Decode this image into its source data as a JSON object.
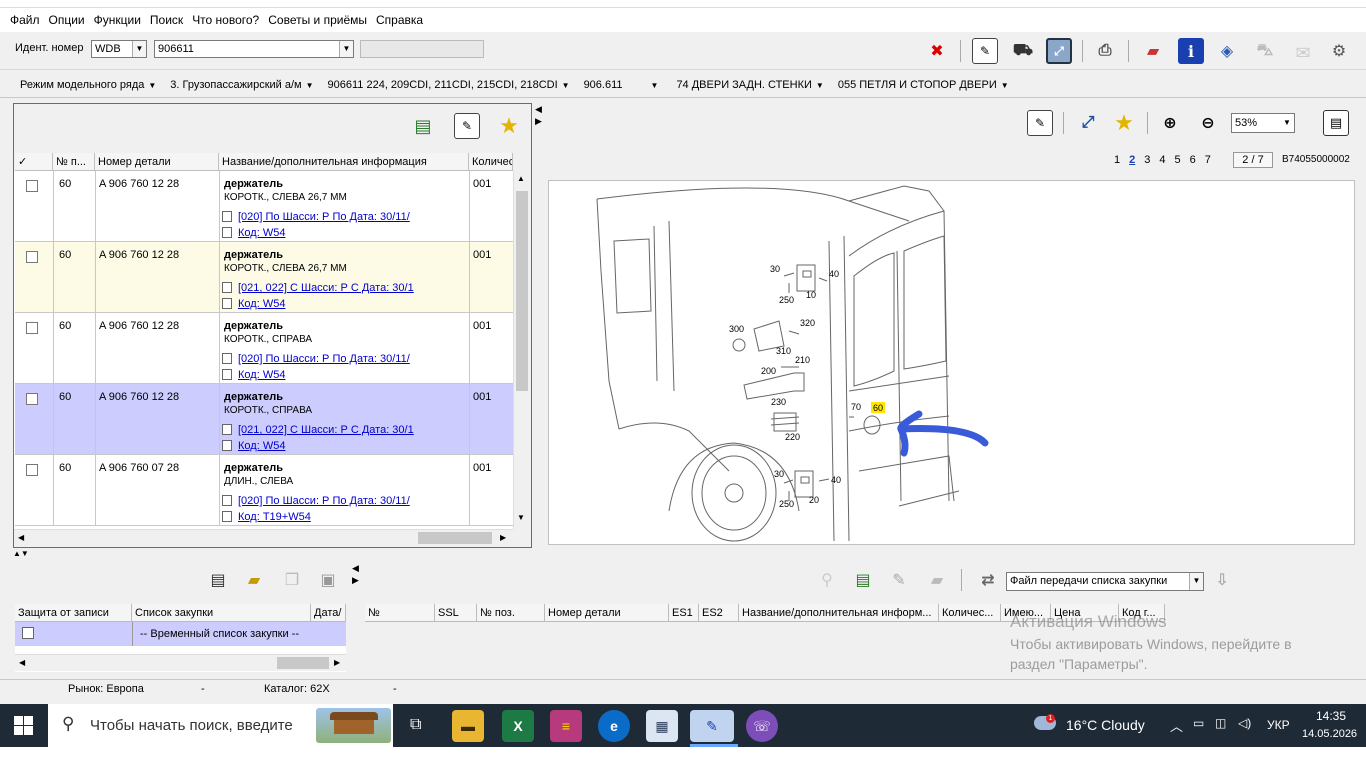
{
  "menu": [
    "Файл",
    "Опции",
    "Функции",
    "Поиск",
    "Что нового?",
    "Советы и приёмы",
    "Справка"
  ],
  "ident": {
    "label": "Идент. номер",
    "prefix": "WDB",
    "number": "906611"
  },
  "nav": [
    "Режим модельного ряда",
    "3. Грузопассажирский а/м",
    "906611 224, 209CDI, 211CDI, 215CDI, 218CDI",
    "906.611",
    "74 ДВЕРИ ЗАДН. СТЕНКИ",
    "055 ПЕТЛЯ И СТОПОР ДВЕРИ"
  ],
  "parts_table": {
    "headers": {
      "check": "✓",
      "pos": "№ п...",
      "part_no": "Номер детали",
      "name": "Название/дополнительная информация",
      "qty": "Количес"
    },
    "rows": [
      {
        "pos": "60",
        "part_no": "A 906 760 12 28",
        "name": "держатель",
        "desc": "КОРОТК., СЛЕВА 26,7 ММ",
        "qty": "001",
        "link1": "[020] По Шасси: Р По Дата: 30/11/",
        "link2": "Код: W54",
        "bg": "#ffffff"
      },
      {
        "pos": "60",
        "part_no": "A 906 760 12 28",
        "name": "держатель",
        "desc": "КОРОТК., СЛЕВА 26,7 ММ",
        "qty": "001",
        "link1": "[021, 022] С Шасси: Р С Дата: 30/1",
        "link2": "Код: W54",
        "bg": "#fdfbe6"
      },
      {
        "pos": "60",
        "part_no": "A 906 760 12 28",
        "name": "держатель",
        "desc": "КОРОТК., СПРАВА",
        "qty": "001",
        "link1": "[020] По Шасси: Р По Дата: 30/11/",
        "link2": "Код: W54",
        "bg": "#ffffff"
      },
      {
        "pos": "60",
        "part_no": "A 906 760 12 28",
        "name": "держатель",
        "desc": "КОРОТК., СПРАВА",
        "qty": "001",
        "link1": "[021, 022] С Шасси: Р С Дата: 30/1",
        "link2": "Код: W54",
        "bg": "#ccccff"
      },
      {
        "pos": "60",
        "part_no": "A 906 760 07 28",
        "name": "держатель",
        "desc": "ДЛИН., СЛЕВА",
        "qty": "001",
        "link1": "[020] По Шасси: Р По Дата: 30/11/",
        "link2": "Код: T19+W54",
        "bg": "#ffffff"
      }
    ]
  },
  "viewer": {
    "zoom": "53%",
    "pages": [
      "1",
      "2",
      "3",
      "4",
      "5",
      "6",
      "7"
    ],
    "current_page": "2",
    "page_of": "2 / 7",
    "image_code": "B74055000002"
  },
  "diagram_labels": {
    "l30a": "30",
    "l40a": "40",
    "l250a": "250",
    "l10": "10",
    "l300": "300",
    "l320": "320",
    "l310": "310",
    "l210": "210",
    "l200": "200",
    "l230": "230",
    "l220": "220",
    "l70": "70",
    "l60": "60",
    "l30b": "30",
    "l40b": "40",
    "l250b": "250",
    "l20": "20"
  },
  "shopping": {
    "headers": [
      "Защита от записи",
      "Список закупки",
      "Дата/"
    ],
    "row": "-- Временный список закупки --"
  },
  "transfer": {
    "combo": "Файл передачи списка закупки",
    "headers": [
      "№",
      "SSL",
      "№ поз.",
      "Номер детали",
      "ES1",
      "ES2",
      "Название/дополнительная информ...",
      "Количес...",
      "Имею...",
      "Цена",
      "Код г..."
    ]
  },
  "watermark": {
    "title": "Активация Windows",
    "line1": "Чтобы активировать Windows, перейдите в",
    "line2": "раздел \"Параметры\"."
  },
  "status": {
    "market": "Рынок: Европа",
    "dash1": "-",
    "catalog": "Каталог: 62X",
    "dash2": "-"
  },
  "taskbar": {
    "search": "Чтобы начать поиск, введите",
    "weather": "16°C  Cloudy",
    "lang": "УКР",
    "time": "14:35",
    "date": "14.05.2026"
  },
  "colors": {
    "highlight_purple": "#ccccff",
    "highlight_yellow": "#fdfbe6",
    "panel_border": "#e03a3a",
    "link": "#0000cc",
    "arrow": "#3a5bd9"
  }
}
